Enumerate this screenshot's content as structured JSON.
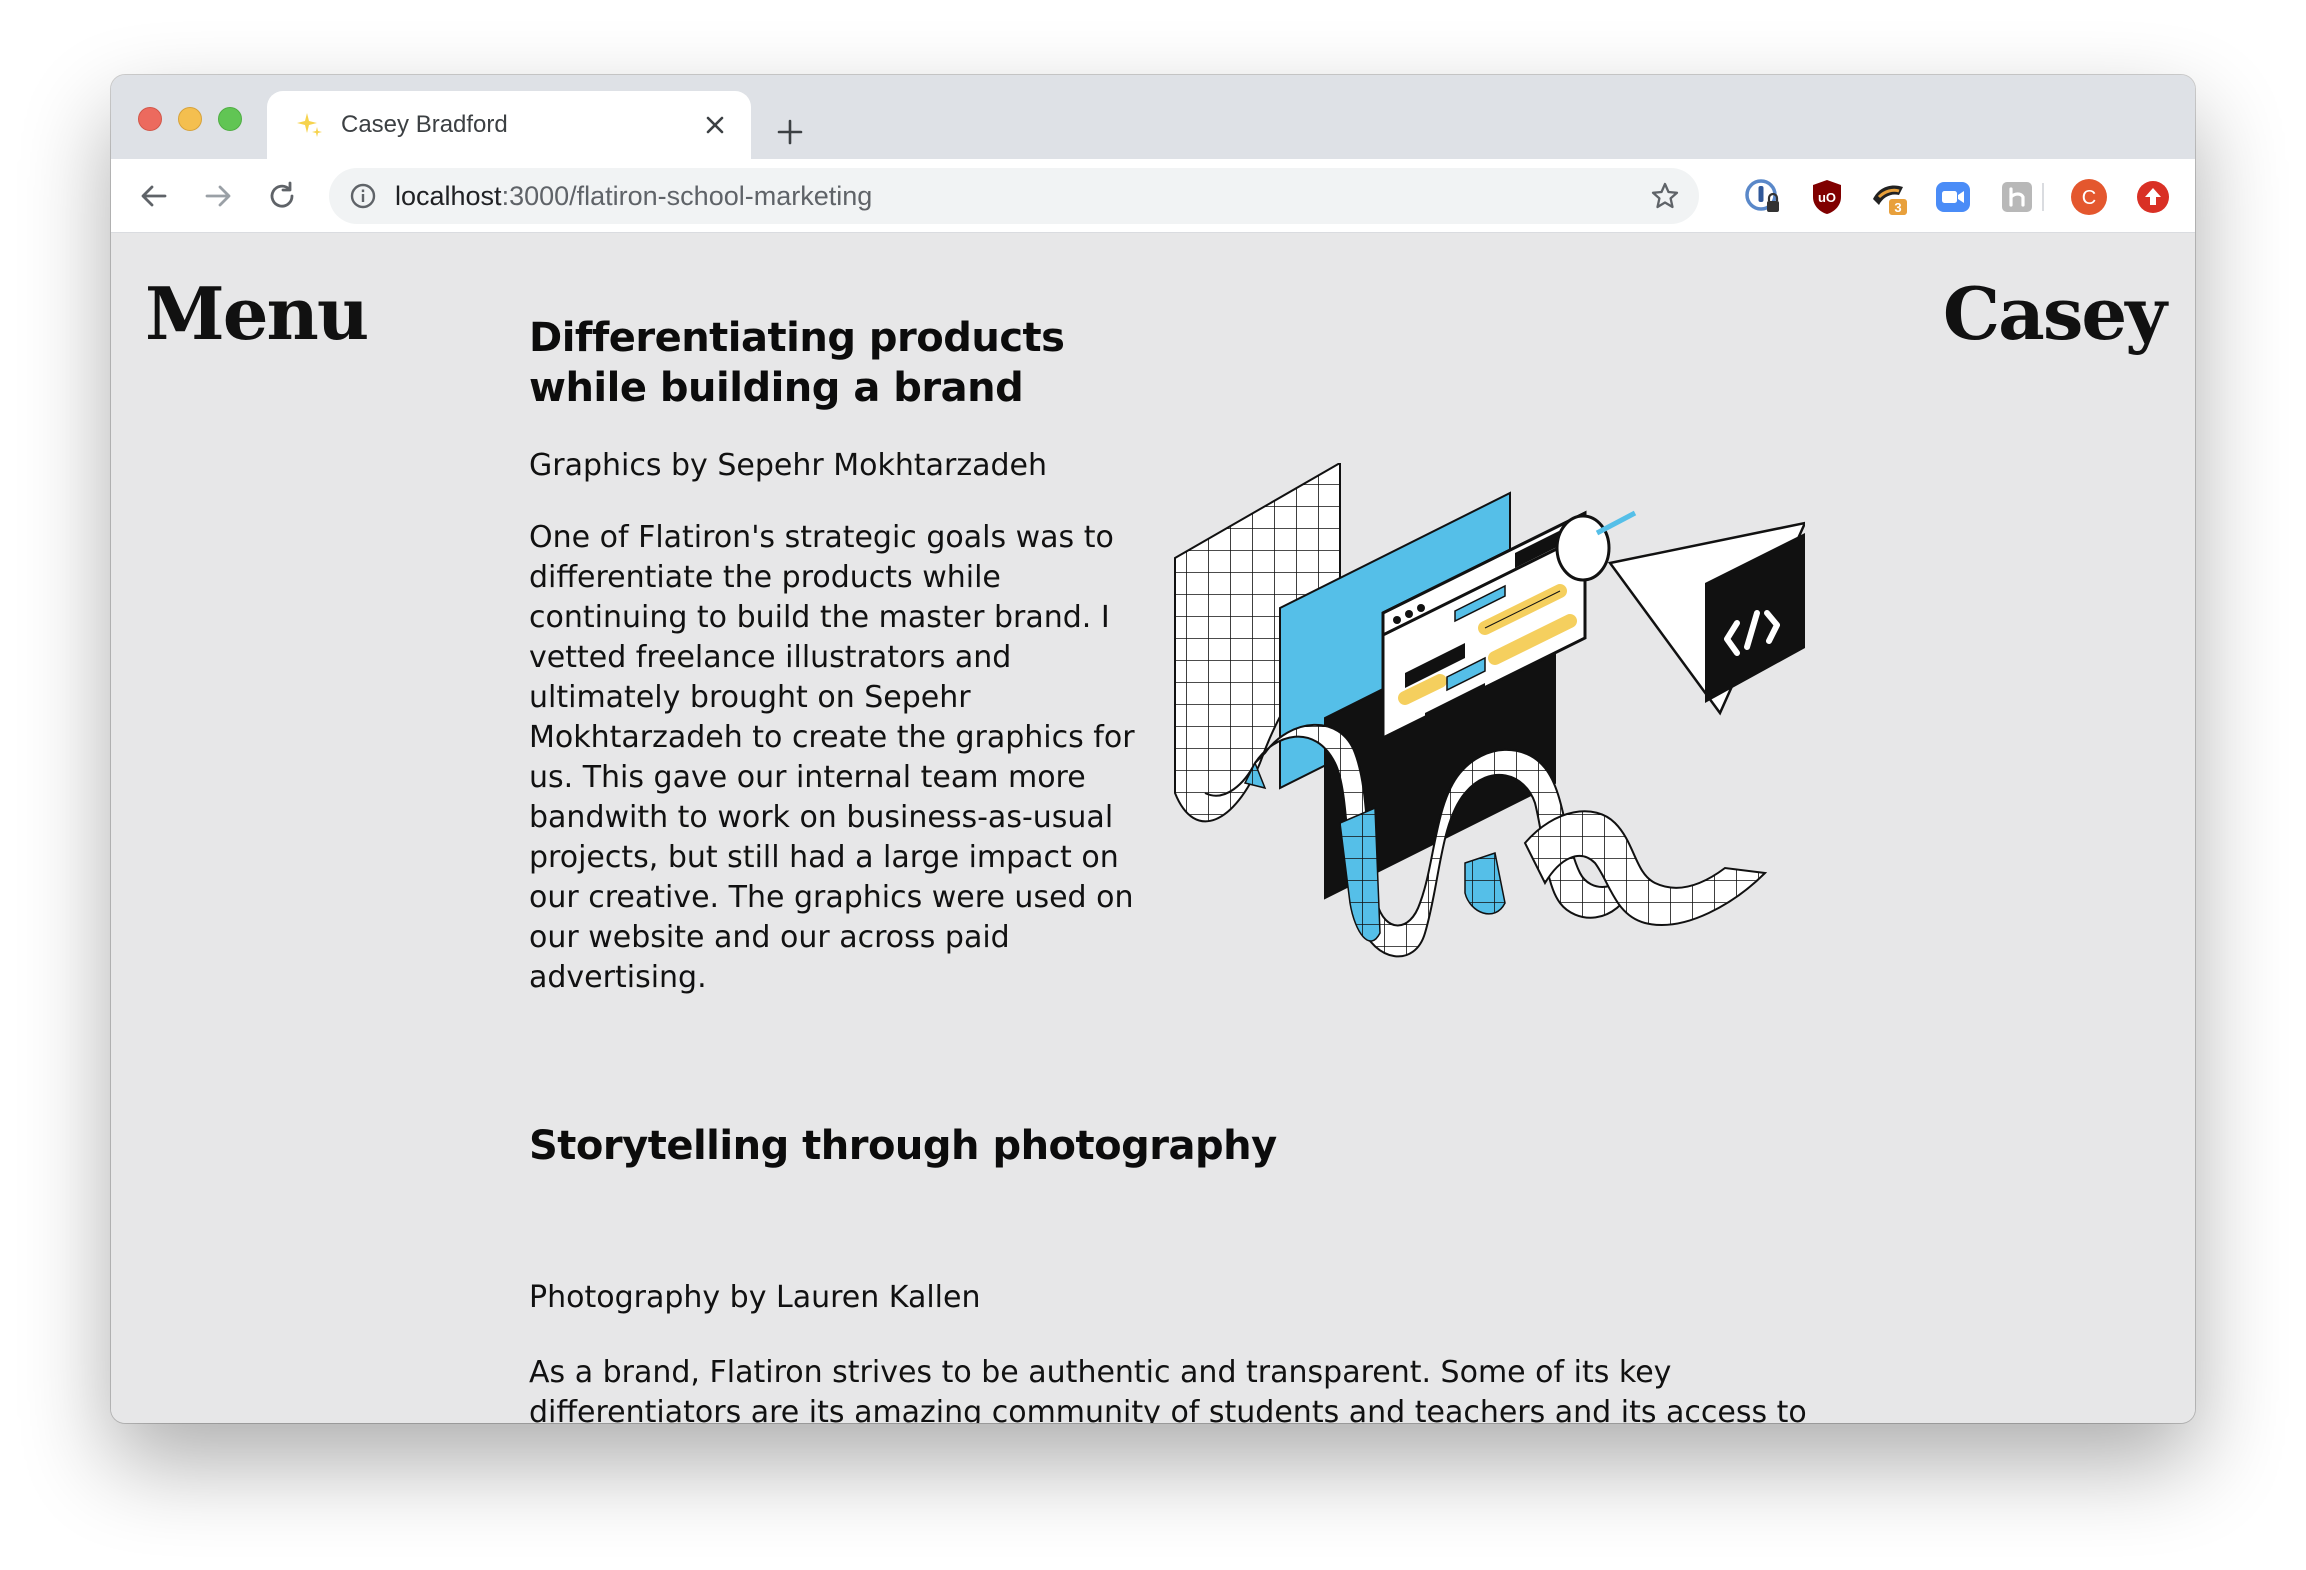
{
  "browser": {
    "tab": {
      "title": "Casey Bradford",
      "favicon": "sparkle-icon"
    },
    "address_bar": {
      "host": "localhost",
      "path": ":3000/flatiron-school-marketing"
    },
    "extensions": [
      "onepassword-icon",
      "ublock-origin-icon",
      "honey-icon",
      "zoom-icon",
      "ninja-icon",
      "profile-avatar",
      "update-icon"
    ],
    "extension_badge": "3",
    "profile_initial": "C"
  },
  "page": {
    "menu_label": "Menu",
    "brand_label": "Casey",
    "sections": [
      {
        "heading": "Differentiating products while building a brand",
        "credit": "Graphics by Sepehr Mokhtarzadeh",
        "body": "One of Flatiron's strategic goals was to differentiate the products while continuing to build the master brand. I vetted freelance illustrators and ultimately brought on Sepehr Mokhtarzadeh to create the graphics for us. This gave our internal team more bandwith to work on business-as-usual projects, but still had a large impact on our creative. The graphics were used on our website and our across paid advertising."
      },
      {
        "heading": "Storytelling through photography",
        "credit": "Photography by Lauren Kallen",
        "body": "As a brand, Flatiron strives to be authentic and transparent. Some of its key differentiators are its amazing community of students and teachers and its access to beautiful WeWork spaces. I wanted to capture photography that showed real students working together in these comfortable and inspiring"
      }
    ]
  },
  "colors": {
    "accent_blue": "#55bfe8",
    "accent_yellow": "#f5cf5e",
    "page_bg": "#e7e7e8"
  }
}
